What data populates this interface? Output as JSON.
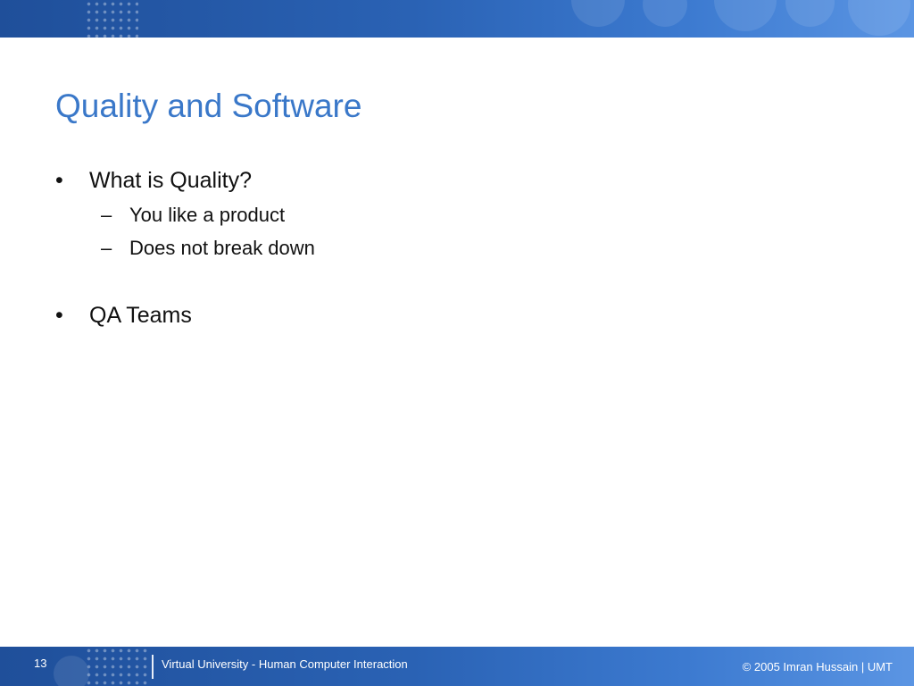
{
  "slide": {
    "title": "Quality and Software",
    "bullets": [
      {
        "marker": "•",
        "text": "What is Quality?",
        "subitems": [
          {
            "marker": "–",
            "text": "You like a product"
          },
          {
            "marker": "–",
            "text": "Does not break down"
          }
        ]
      },
      {
        "marker": "•",
        "text": "QA Teams",
        "subitems": []
      }
    ]
  },
  "footer": {
    "slide_number": "13",
    "course": "Virtual University - Human Computer Interaction",
    "copyright": "© 2005 Imran Hussain | UMT"
  },
  "colors": {
    "title": "#3a78c9",
    "banner_dark": "#1f4f9a",
    "banner_light": "#5b95e3",
    "body_text": "#111111"
  }
}
